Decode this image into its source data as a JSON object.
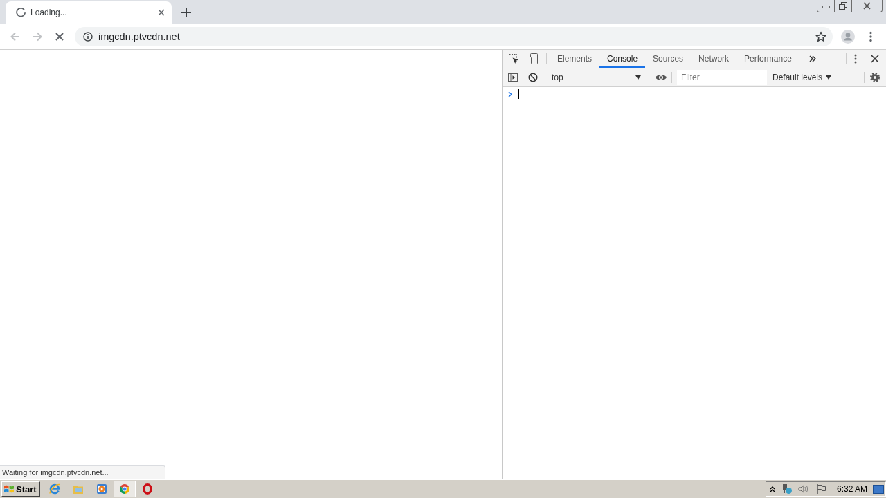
{
  "browser": {
    "loading": true,
    "tabs": [
      {
        "title": "Loading...",
        "selected": true
      }
    ],
    "navigation": {
      "back": {
        "disabled": true
      },
      "forward": {
        "disabled": true
      }
    },
    "address_bar": {
      "url": "imgcdn.ptvcdn.net",
      "bookmarked": false
    },
    "status_bubble": "Waiting for imgcdn.ptvcdn.net..."
  },
  "devtools": {
    "tabs": [
      {
        "label": "Elements",
        "selected": false
      },
      {
        "label": "Console",
        "selected": true
      },
      {
        "label": "Sources",
        "selected": false
      },
      {
        "label": "Network",
        "selected": false
      },
      {
        "label": "Performance",
        "selected": false
      }
    ],
    "console": {
      "context": "top",
      "filter": {
        "placeholder": "Filter"
      },
      "levels": "Default levels"
    }
  },
  "taskbar": {
    "start": "Start",
    "apps": [
      {
        "kind": "ie",
        "selected": false
      },
      {
        "kind": "folder",
        "selected": false
      },
      {
        "kind": "media",
        "selected": false
      },
      {
        "kind": "chrome",
        "selected": true
      },
      {
        "kind": "opera",
        "selected": false
      }
    ],
    "clock": "6:32 AM"
  }
}
